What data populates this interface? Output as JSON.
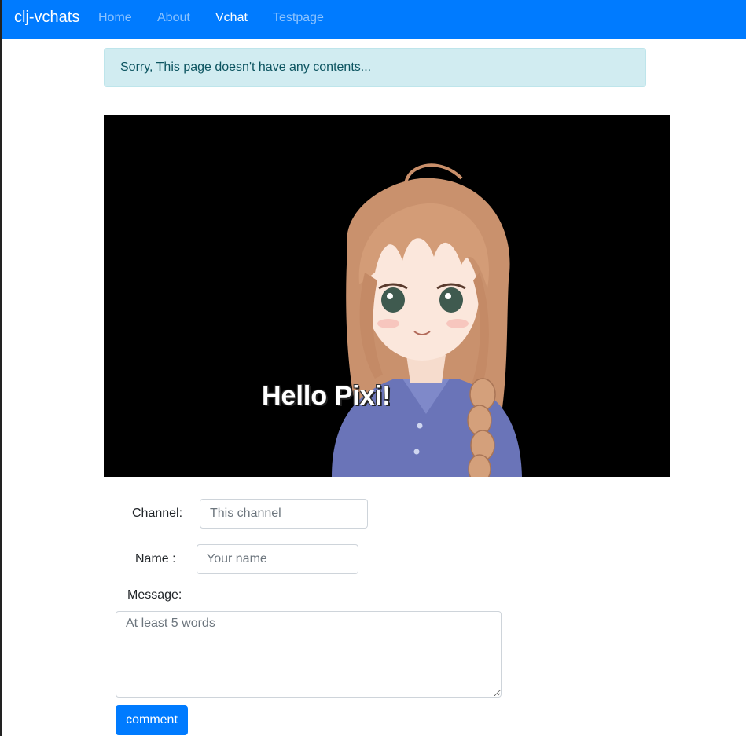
{
  "navbar": {
    "brand": "clj-vchats",
    "items": [
      {
        "label": "Home",
        "active": false
      },
      {
        "label": "About",
        "active": false
      },
      {
        "label": "Vchat",
        "active": true
      },
      {
        "label": "Testpage",
        "active": false
      }
    ],
    "background": "#007bff"
  },
  "alert": {
    "text": "Sorry, This page doesn't have any contents..."
  },
  "stage": {
    "text": "Hello Pixi!",
    "background": "#000000"
  },
  "form": {
    "channel_label": "Channel:",
    "channel_placeholder": "This channel",
    "name_label": "Name :",
    "name_placeholder": "Your name",
    "message_label": "Message:",
    "message_placeholder": "At least 5 words",
    "submit_label": "comment"
  }
}
